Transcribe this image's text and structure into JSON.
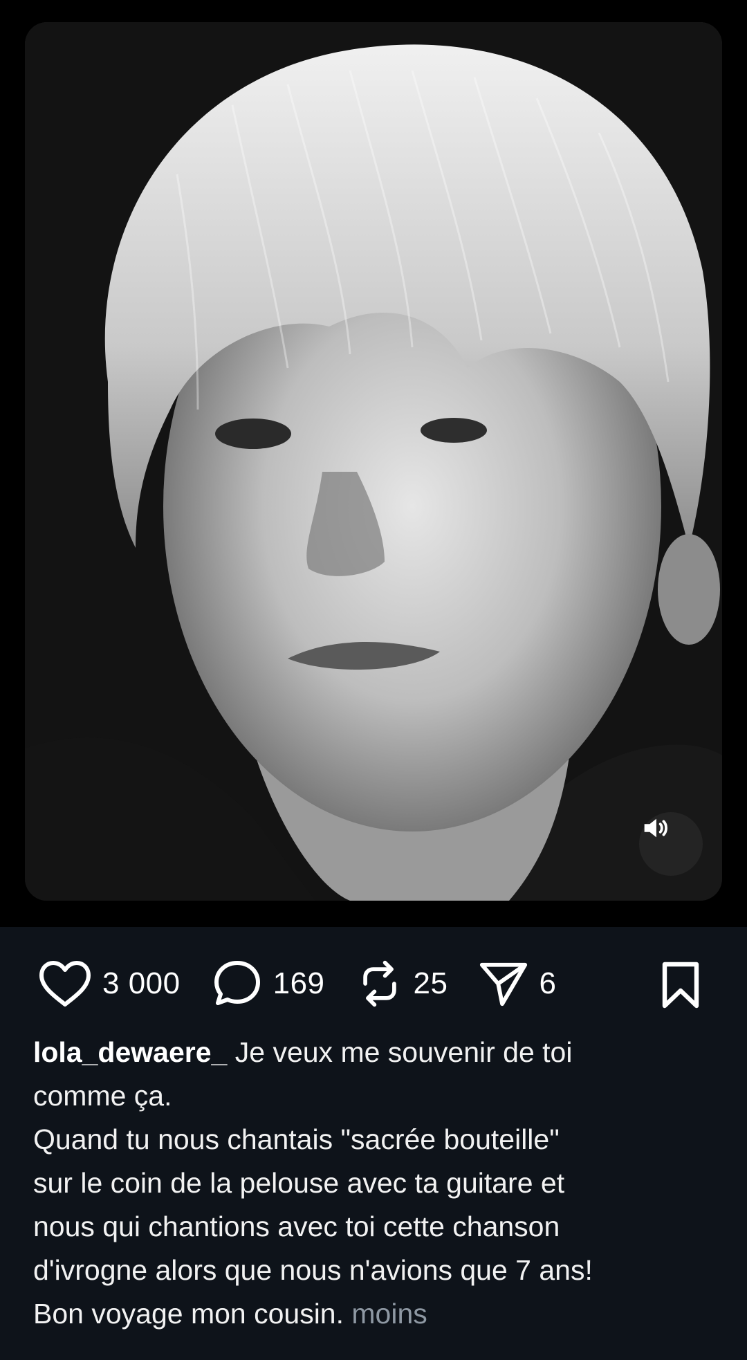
{
  "post": {
    "media": {
      "description": "black and white portrait photo",
      "sound_icon": "volume-on-icon"
    },
    "actions": {
      "likes": {
        "icon": "heart-icon",
        "count": "3 000"
      },
      "comments": {
        "icon": "comment-bubble-icon",
        "count": "169"
      },
      "reposts": {
        "icon": "repost-icon",
        "count": "25"
      },
      "shares": {
        "icon": "send-icon",
        "count": "6"
      },
      "bookmark": {
        "icon": "bookmark-icon"
      }
    },
    "caption": {
      "username": "lola_dewaere_",
      "line1": "Je veux me souvenir de toi",
      "line2": "comme ça.",
      "line3": "Quand tu nous chantais \"sacrée bouteille\"",
      "line4": "sur le coin de la pelouse avec ta guitare et",
      "line5": "nous qui chantions avec toi cette chanson",
      "line6": "d'ivrogne alors que nous n'avions que 7 ans!",
      "line7": "Bon voyage mon cousin.",
      "less_link": "moins"
    }
  },
  "colors": {
    "background": "#0e131a",
    "text": "#ffffff",
    "muted": "#8e98a3"
  }
}
